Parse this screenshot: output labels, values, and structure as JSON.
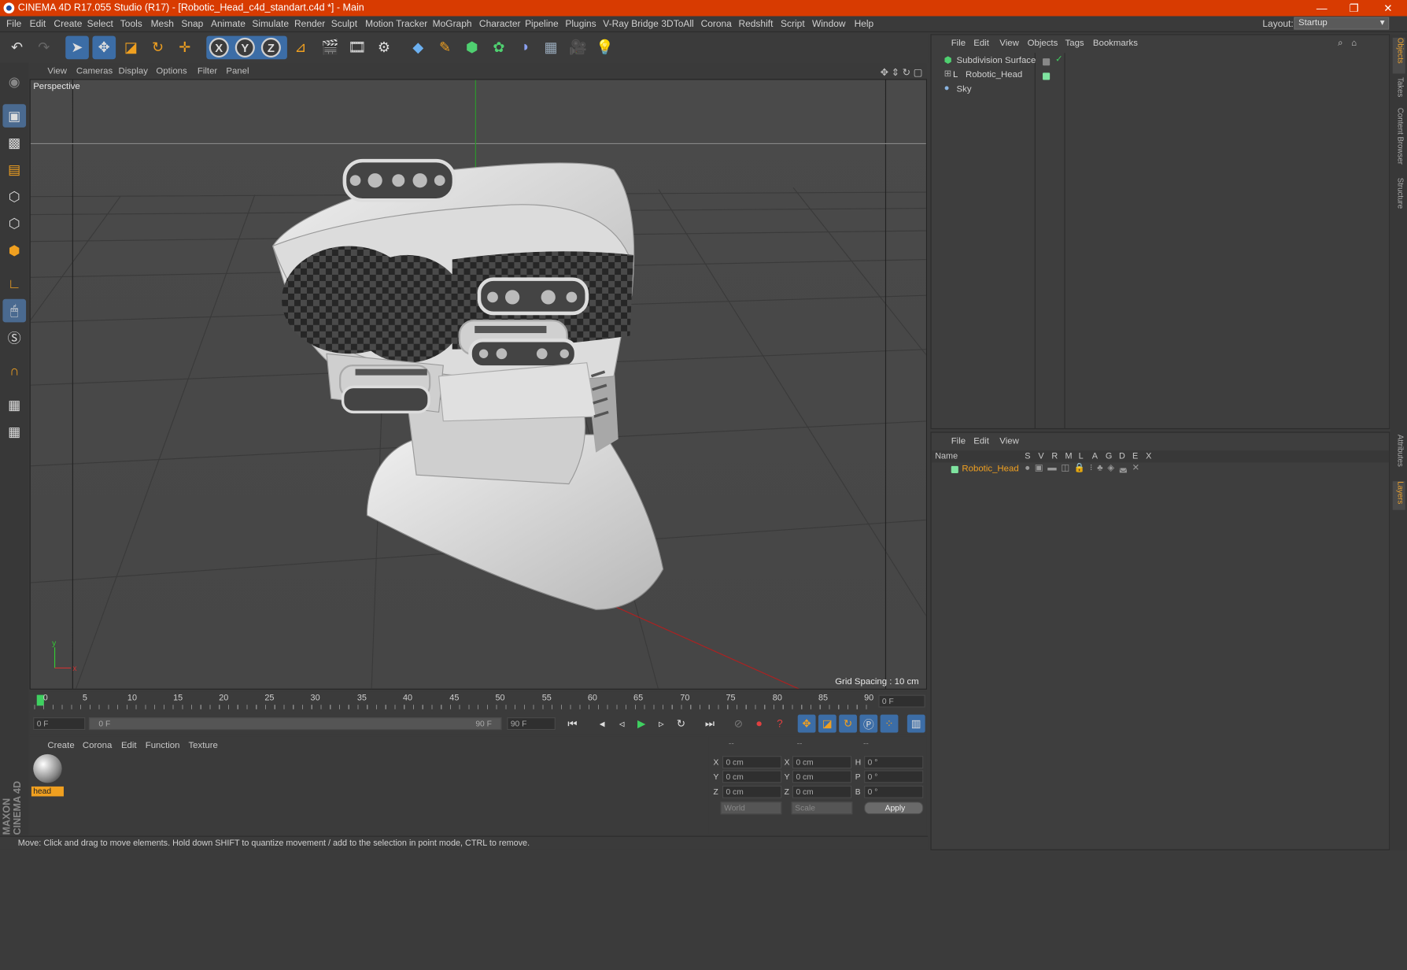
{
  "window": {
    "title": "CINEMA 4D R17.055 Studio (R17) - [Robotic_Head_c4d_standart.c4d *] - Main",
    "minimize": "—",
    "restore": "❐",
    "close": "✕"
  },
  "menu": [
    "File",
    "Edit",
    "Create",
    "Select",
    "Tools",
    "Mesh",
    "Snap",
    "Animate",
    "Simulate",
    "Render",
    "Sculpt",
    "Motion Tracker",
    "MoGraph",
    "Character",
    "Pipeline",
    "Plugins",
    "V-Ray Bridge",
    "3DToAll",
    "Corona",
    "Redshift",
    "Script",
    "Window",
    "Help"
  ],
  "layout": {
    "label": "Layout:",
    "value": "Startup"
  },
  "viewport": {
    "menu": [
      "View",
      "Cameras",
      "Display",
      "Options",
      "Filter",
      "Panel"
    ],
    "label": "Perspective",
    "grid_spacing": "Grid Spacing : 10 cm"
  },
  "timeline": {
    "ticks": [
      "0",
      "5",
      "10",
      "15",
      "20",
      "25",
      "30",
      "35",
      "40",
      "45",
      "50",
      "55",
      "60",
      "65",
      "70",
      "75",
      "80",
      "85",
      "90"
    ],
    "current_frame": "0 F"
  },
  "transport": {
    "start": "0 F",
    "slider_start": "0 F",
    "slider_end": "90 F",
    "end": "90 F"
  },
  "materials": {
    "menu": [
      "Create",
      "Corona",
      "Edit",
      "Function",
      "Texture"
    ],
    "items": [
      {
        "name": "head"
      }
    ]
  },
  "coords": {
    "headers": [
      "--",
      "--",
      "--"
    ],
    "rows": [
      {
        "a": "X",
        "v1": "0 cm",
        "b": "X",
        "v2": "0 cm",
        "c": "H",
        "v3": "0 °"
      },
      {
        "a": "Y",
        "v1": "0 cm",
        "b": "Y",
        "v2": "0 cm",
        "c": "P",
        "v3": "0 °"
      },
      {
        "a": "Z",
        "v1": "0 cm",
        "b": "Z",
        "v2": "0 cm",
        "c": "B",
        "v3": "0 °"
      }
    ],
    "world": "World",
    "scale": "Scale",
    "apply": "Apply"
  },
  "status": "Move: Click and drag to move elements. Hold down SHIFT to quantize movement / add to the selection in point mode, CTRL to remove.",
  "objects": {
    "menu": [
      "File",
      "Edit",
      "View",
      "Objects",
      "Tags",
      "Bookmarks"
    ],
    "items": [
      {
        "name": "Subdivision Surface"
      },
      {
        "name": "Robotic_Head"
      },
      {
        "name": "Sky"
      }
    ]
  },
  "layers": {
    "menu": [
      "File",
      "Edit",
      "View"
    ],
    "columns": [
      "Name",
      "S",
      "V",
      "R",
      "M",
      "L",
      "A",
      "G",
      "D",
      "E",
      "X"
    ],
    "items": [
      {
        "name": "Robotic_Head",
        "color": "#7fe3a0"
      }
    ]
  },
  "sidetabs": [
    "Objects",
    "Takes",
    "Content Browser",
    "Structure",
    "Attributes",
    "Layers"
  ],
  "brand": "MAXON CINEMA 4D"
}
